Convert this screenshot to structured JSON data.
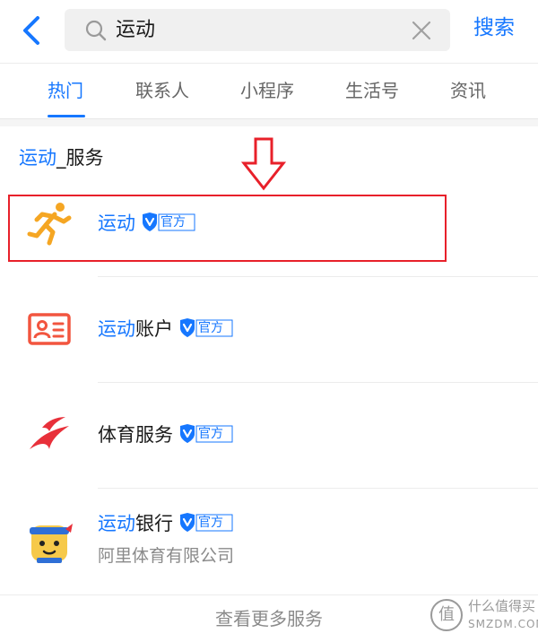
{
  "search": {
    "query": "运动",
    "action_label": "搜索",
    "back_icon": "chevron-left-icon",
    "search_icon": "search-icon",
    "clear_icon": "close-icon"
  },
  "tabs": [
    {
      "label": "热门",
      "active": true
    },
    {
      "label": "联系人",
      "active": false
    },
    {
      "label": "小程序",
      "active": false
    },
    {
      "label": "生活号",
      "active": false
    },
    {
      "label": "资讯",
      "active": false
    }
  ],
  "section": {
    "title_highlight": "运动",
    "title_rest": "_服务"
  },
  "items": [
    {
      "name_highlight": "运动",
      "name_rest": "",
      "badge": "官方",
      "icon": "running-man-icon",
      "subtitle": ""
    },
    {
      "name_highlight": "运动",
      "name_rest": "账户",
      "badge": "官方",
      "icon": "id-card-icon",
      "subtitle": ""
    },
    {
      "name_highlight": "",
      "name_rest": "体育服务",
      "badge": "官方",
      "icon": "swoosh-logo-icon",
      "subtitle": ""
    },
    {
      "name_highlight": "运动",
      "name_rest": "银行",
      "badge": "官方",
      "icon": "headband-mascot-icon",
      "subtitle": "阿里体育有限公司"
    }
  ],
  "more_label": "查看更多服务",
  "watermark": {
    "circle_char": "值",
    "cn": "什么值得买",
    "en": "SMZDM.COM"
  },
  "colors": {
    "accent": "#1677ff",
    "highlight_box": "#e8202a",
    "running_icon": "#f5a623",
    "id_card_icon": "#f2553f",
    "swoosh_icon": "#e8303a",
    "mascot_face": "#f6c94a"
  }
}
